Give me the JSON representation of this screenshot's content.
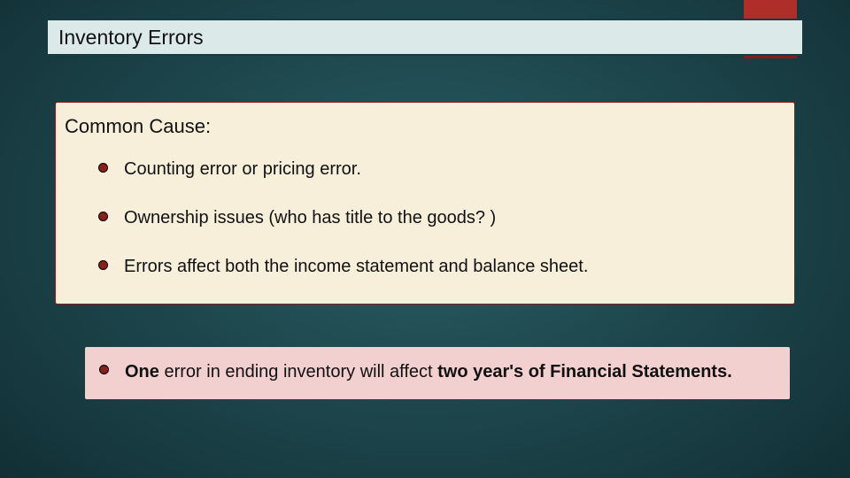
{
  "title": "Inventory Errors",
  "content": {
    "heading": "Common Cause:",
    "bullets": [
      "Counting error or pricing error.",
      "Ownership issues (who has title to the goods? )",
      "Errors affect both the income statement and balance sheet."
    ]
  },
  "callout": {
    "pre": "One",
    "mid": " error in ending inventory will affect ",
    "bold2": "two year's of Financial Statements."
  },
  "colors": {
    "accent": "#b02e2a",
    "bullet": "#8a1f1c",
    "contentBg": "#f7efda",
    "calloutBg": "#f2d0cf",
    "titleBg": "#dbe9e9"
  }
}
